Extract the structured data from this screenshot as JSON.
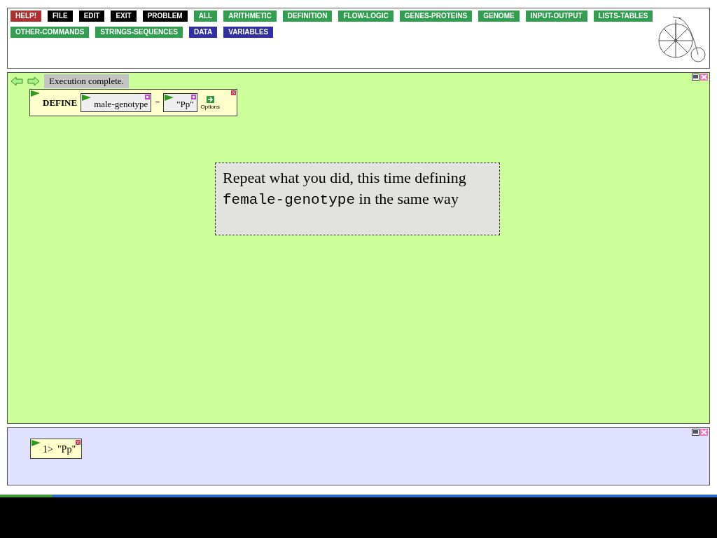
{
  "toolbar": {
    "buttons": [
      {
        "label": "HELP!",
        "kind": "help"
      },
      {
        "label": "FILE",
        "kind": "system"
      },
      {
        "label": "EDIT",
        "kind": "system"
      },
      {
        "label": "EXIT",
        "kind": "system"
      },
      {
        "label": "PROBLEM",
        "kind": "system"
      },
      {
        "label": "ALL",
        "kind": "category"
      },
      {
        "label": "ARITHMETIC",
        "kind": "category"
      },
      {
        "label": "DEFINITION",
        "kind": "category"
      },
      {
        "label": "FLOW-LOGIC",
        "kind": "category"
      },
      {
        "label": "GENES-PROTEINS",
        "kind": "category"
      },
      {
        "label": "GENOME",
        "kind": "category"
      },
      {
        "label": "INPUT-OUTPUT",
        "kind": "category"
      },
      {
        "label": "LISTS-TABLES",
        "kind": "category"
      },
      {
        "label": "OTHER-COMMANDS",
        "kind": "category"
      },
      {
        "label": "STRINGS-SEQUENCES",
        "kind": "category"
      },
      {
        "label": "DATA",
        "kind": "data"
      },
      {
        "label": "VARIABLES",
        "kind": "data"
      }
    ]
  },
  "workspace": {
    "status": "Execution complete.",
    "define_box": {
      "keyword": "DEFINE",
      "name": "male-genotype",
      "operator": "=",
      "value": "\"Pp\"",
      "options": "Options"
    },
    "note": {
      "before": "Repeat what you did, this time defining",
      "code": "female-genotype",
      "after": "in the same way"
    }
  },
  "results": {
    "items": [
      {
        "prompt": "1>",
        "value": "\"Pp\""
      }
    ]
  }
}
